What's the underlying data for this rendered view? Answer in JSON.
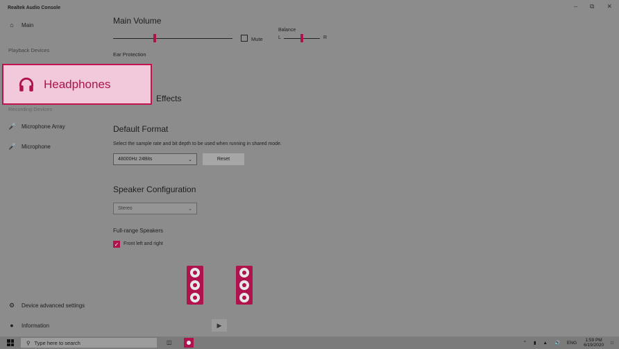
{
  "app": {
    "title": "Realtek Audio Console"
  },
  "window_controls": {
    "minimize": "–",
    "restore": "⧉",
    "close": "✕"
  },
  "sidebar": {
    "main": {
      "icon": "home-icon",
      "label": "Main"
    },
    "playback_section": "Playback Devices",
    "recording_section": "Recording Devices",
    "recording_items": [
      {
        "icon": "microphone-icon",
        "label": "Microphone Array"
      },
      {
        "icon": "microphone-icon",
        "label": "Microphone"
      }
    ],
    "footer": [
      {
        "icon": "gear-icon",
        "label": "Device advanced settings"
      },
      {
        "icon": "info-icon",
        "label": "Information"
      }
    ]
  },
  "highlight": {
    "icon": "headphones-icon",
    "label": "Headphones"
  },
  "main": {
    "main_volume": {
      "title": "Main Volume",
      "level": 0.35
    },
    "mute": {
      "label": "Mute",
      "checked": false
    },
    "balance": {
      "title": "Balance",
      "left": "L",
      "right": "R",
      "level": 0.5
    },
    "ear_protection": "Ear Protection",
    "effects_title": "Effects",
    "default_format": {
      "title": "Default Format",
      "description": "Select the sample rate and bit depth to be used when running in shared mode.",
      "selected": "48000Hz 24Bits",
      "reset": "Reset"
    },
    "speaker_config": {
      "title": "Speaker Configuration",
      "selected": "Stereo"
    },
    "full_range": {
      "title": "Full-range Speakers",
      "checkbox": "Front left and right",
      "checked": true
    },
    "play_icon": "play-icon"
  },
  "taskbar": {
    "search_placeholder": "Type here to search",
    "language": "ENG",
    "time": "1:59 PM",
    "date": "6/19/2020"
  },
  "colors": {
    "accent": "#b0124e",
    "highlight_bg": "#f1c9da"
  }
}
